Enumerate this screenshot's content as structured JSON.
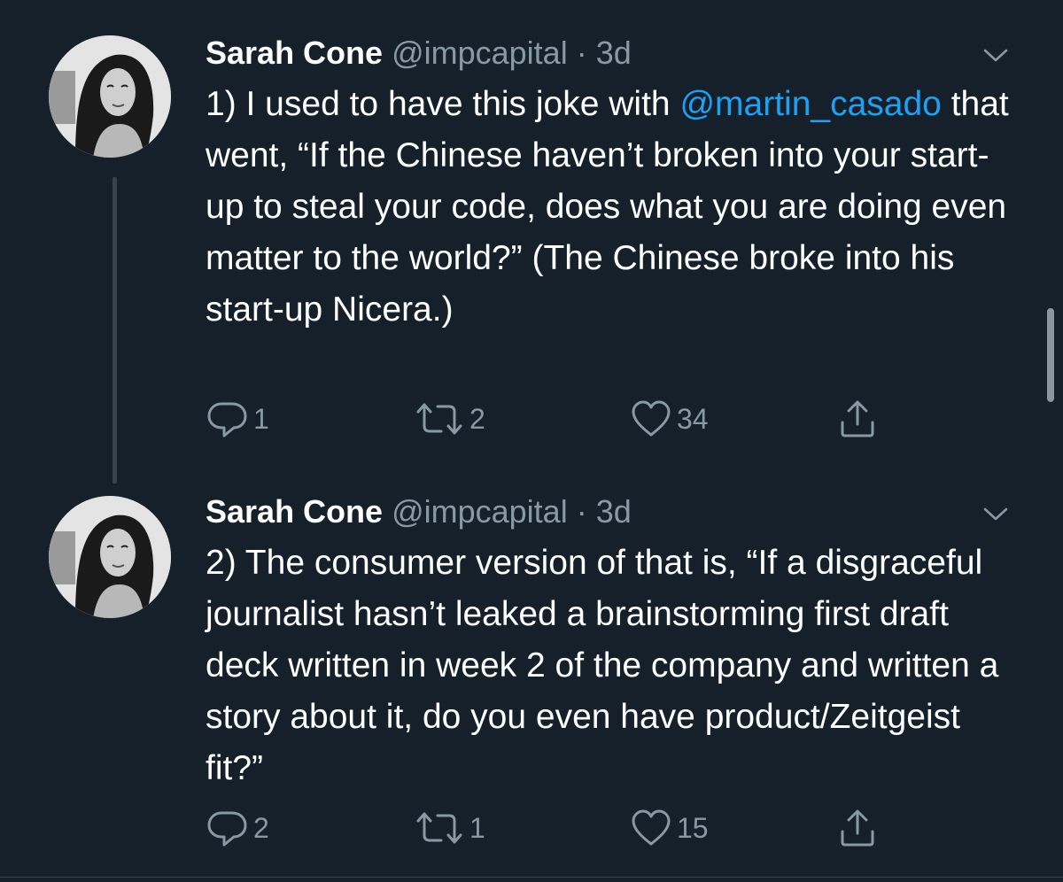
{
  "colors": {
    "background": "#15202b",
    "text_primary": "#ffffff",
    "text_secondary": "#8899a6",
    "link": "#1da1f2",
    "divider": "#38444d"
  },
  "tweets": [
    {
      "author_name": "Sarah Cone",
      "handle": "@impcapital",
      "separator": "·",
      "time": "3d",
      "text_before_mention": "1) I used to have this joke with ",
      "mention": "@martin_casado",
      "text_after_mention": " that went, “If the Chinese haven’t broken into your start-up to steal your code, does what you are doing even matter to the world?” (The Chinese broke into his start-up Nicera.)",
      "reply_count": "1",
      "retweet_count": "2",
      "like_count": "34",
      "icons": [
        "reply-icon",
        "retweet-icon",
        "like-icon",
        "share-icon",
        "chevron-down-icon"
      ]
    },
    {
      "author_name": "Sarah Cone",
      "handle": "@impcapital",
      "separator": "·",
      "time": "3d",
      "text": "2) The consumer version of that is, “If a disgraceful journalist hasn’t leaked a brainstorming first draft deck written in week 2 of the company and written a story about it, do you even have product/Zeitgeist fit?”",
      "reply_count": "2",
      "retweet_count": "1",
      "like_count": "15",
      "icons": [
        "reply-icon",
        "retweet-icon",
        "like-icon",
        "share-icon",
        "chevron-down-icon"
      ]
    }
  ]
}
